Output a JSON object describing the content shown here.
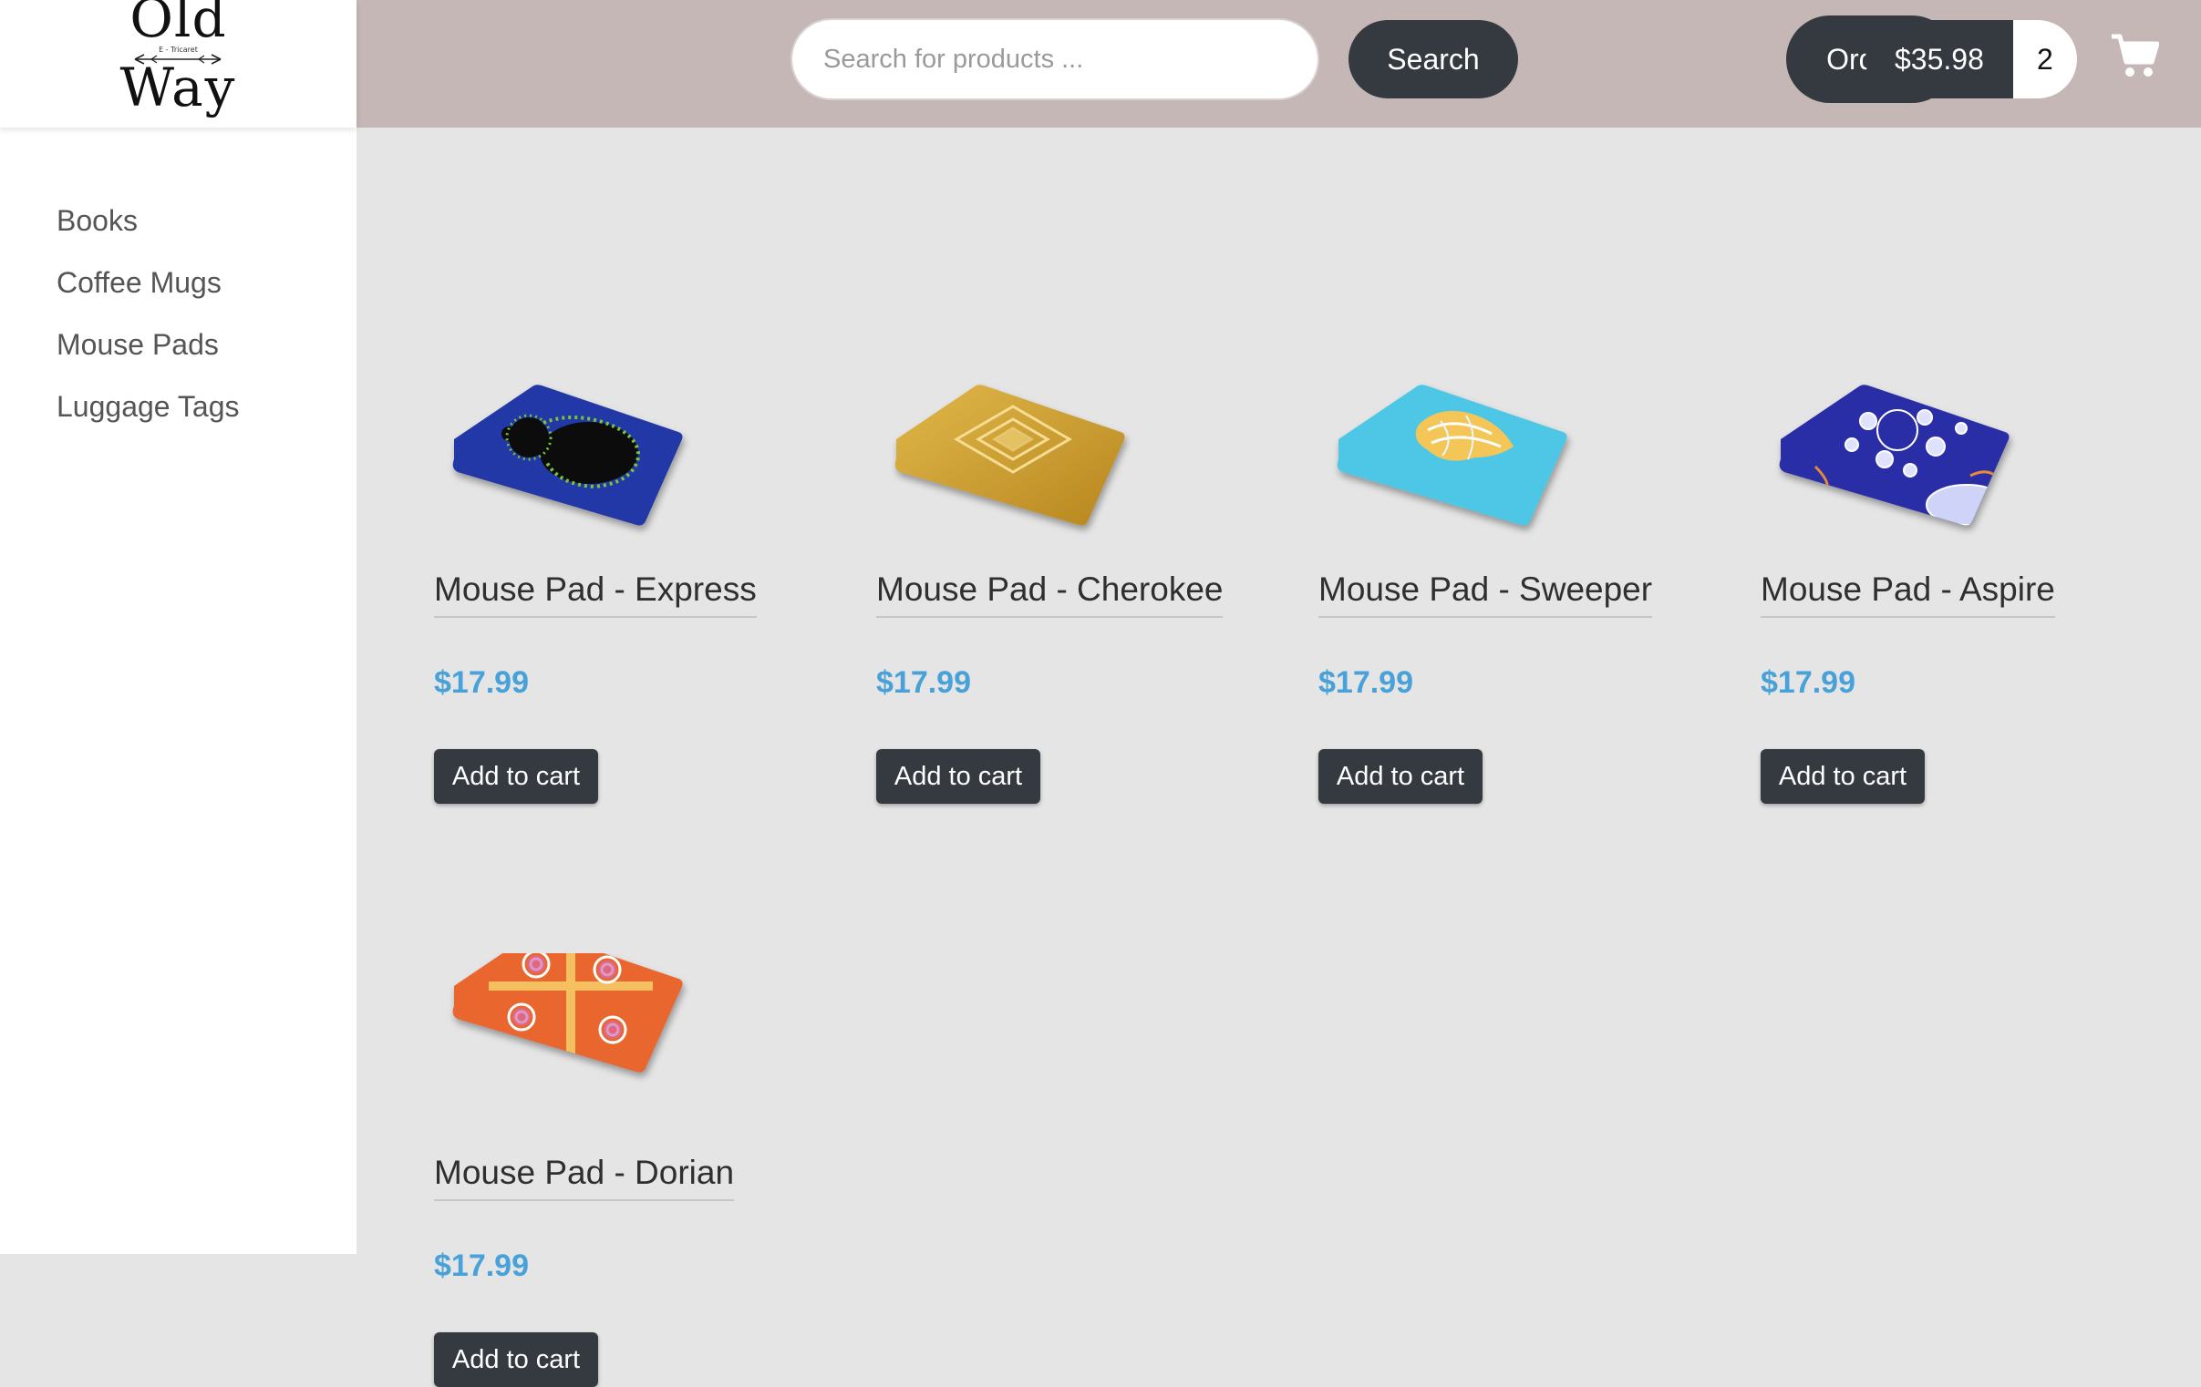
{
  "brand": {
    "line1": "Old",
    "line2": "Way",
    "tagline": "E - Tricaret"
  },
  "header": {
    "search_placeholder": "Search for products ...",
    "search_value": "",
    "search_button": "Search",
    "orders_button": "Orders",
    "cart_total": "$35.98",
    "cart_count": "2",
    "cart_icon": "shopping-cart-icon"
  },
  "sidebar": {
    "items": [
      {
        "label": "Books"
      },
      {
        "label": "Coffee Mugs"
      },
      {
        "label": "Mouse Pads"
      },
      {
        "label": "Luggage Tags"
      }
    ]
  },
  "products": [
    {
      "name": "Mouse Pad - Express",
      "price": "$17.99",
      "button": "Add to cart",
      "image": "mouse-pad-express-image",
      "pattern": "mandelbrot",
      "colors": [
        "#1f3aa8",
        "#0b0b0b",
        "#6fbf3a"
      ]
    },
    {
      "name": "Mouse Pad - Cherokee",
      "price": "$17.99",
      "button": "Add to cart",
      "image": "mouse-pad-cherokee-image",
      "pattern": "diamond",
      "colors": [
        "#d7a93a",
        "#f2d886",
        "#a9781c"
      ]
    },
    {
      "name": "Mouse Pad - Sweeper",
      "price": "$17.99",
      "button": "Add to cart",
      "image": "mouse-pad-sweeper-image",
      "pattern": "swirl",
      "colors": [
        "#4cc6e4",
        "#f2c14e",
        "#ffffff"
      ]
    },
    {
      "name": "Mouse Pad - Aspire",
      "price": "$17.99",
      "button": "Add to cart",
      "image": "mouse-pad-aspire-image",
      "pattern": "bubbles",
      "colors": [
        "#2b2fa8",
        "#ffffff",
        "#e27a2e"
      ]
    },
    {
      "name": "Mouse Pad - Dorian",
      "price": "$17.99",
      "button": "Add to cart",
      "image": "mouse-pad-dorian-image",
      "pattern": "spirals",
      "colors": [
        "#e24a2a",
        "#f3b34a",
        "#d86aa8"
      ]
    }
  ]
}
